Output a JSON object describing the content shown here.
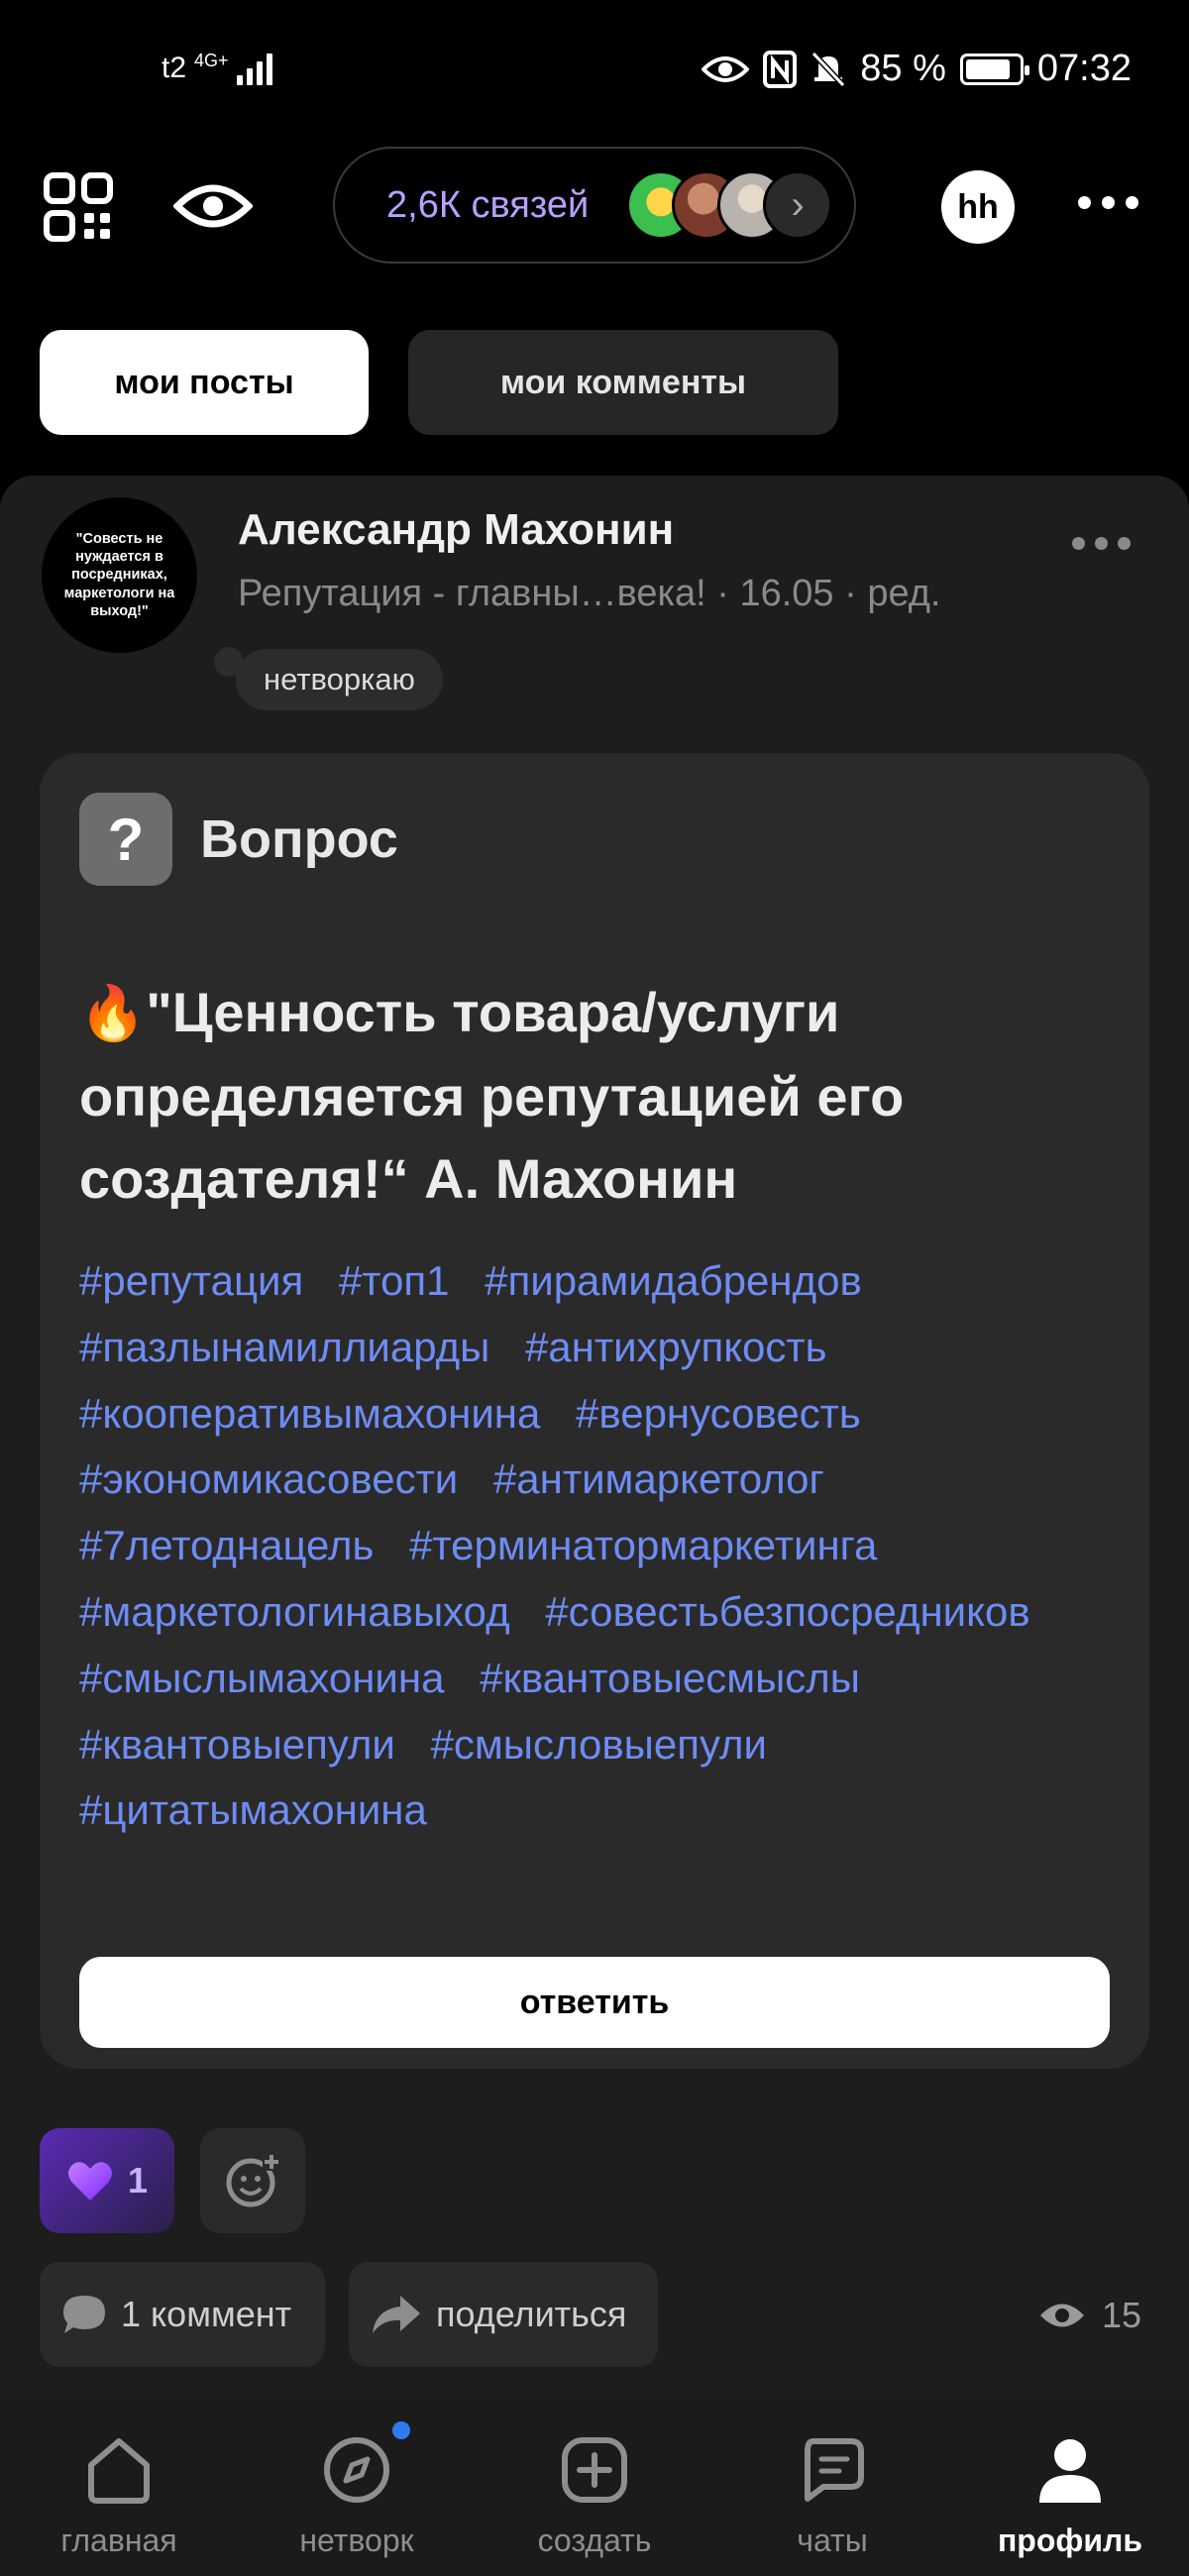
{
  "status_bar": {
    "carrier": "t2",
    "network": "4G+",
    "battery_percent": "85 %",
    "time": "07:32"
  },
  "toolbar": {
    "connections_label": "2,6К связей",
    "profile_badge": "hh"
  },
  "tabs": [
    {
      "label": "мои посты",
      "active": true
    },
    {
      "label": "мои комменты",
      "active": false
    }
  ],
  "post": {
    "author_name": "Александр Махонин",
    "author_avatar_text": "\"Совесть не нуждается в посредниках, маркетологи на выход!\"",
    "meta": "Репутация - главны…века! · 16.05 · ред.",
    "status": "нетворкаю",
    "question_label": "Вопрос",
    "question_icon": "?",
    "question_text": "\"Ценность товара/услуги определяется репутацией его создателя!“ А. Махонин",
    "hashtags": [
      "#репутация",
      "#топ1",
      "#пирамидабрендов",
      "#пазлынамиллиарды",
      "#антихрупкость",
      "#кооперативымахонина",
      "#вернусовесть",
      "#экономикасовести",
      "#антимаркетолог",
      "#7летоднацель",
      "#терминатормаркетинга",
      "#маркетологинавыход",
      "#совестьбезпосредников",
      "#смыслымахонина",
      "#квантовыесмыслы",
      "#квантовыепули",
      "#смысловыепули",
      "#цитатымахонина"
    ],
    "reply_label": "ответить",
    "likes": "1",
    "comment_label": "1 коммент",
    "share_label": "поделиться",
    "views": "15"
  },
  "bottom_nav": [
    {
      "label": "главная",
      "icon": "home-icon"
    },
    {
      "label": "нетворк",
      "icon": "compass-icon"
    },
    {
      "label": "создать",
      "icon": "plus-square-icon"
    },
    {
      "label": "чаты",
      "icon": "chat-icon"
    },
    {
      "label": "профиль",
      "icon": "profile-icon",
      "active": true
    }
  ],
  "colors": {
    "accent_purple": "#b9a0ff",
    "hashtag_blue": "#6e8cf2",
    "background": "#000000",
    "card": "#1d1d1d"
  }
}
